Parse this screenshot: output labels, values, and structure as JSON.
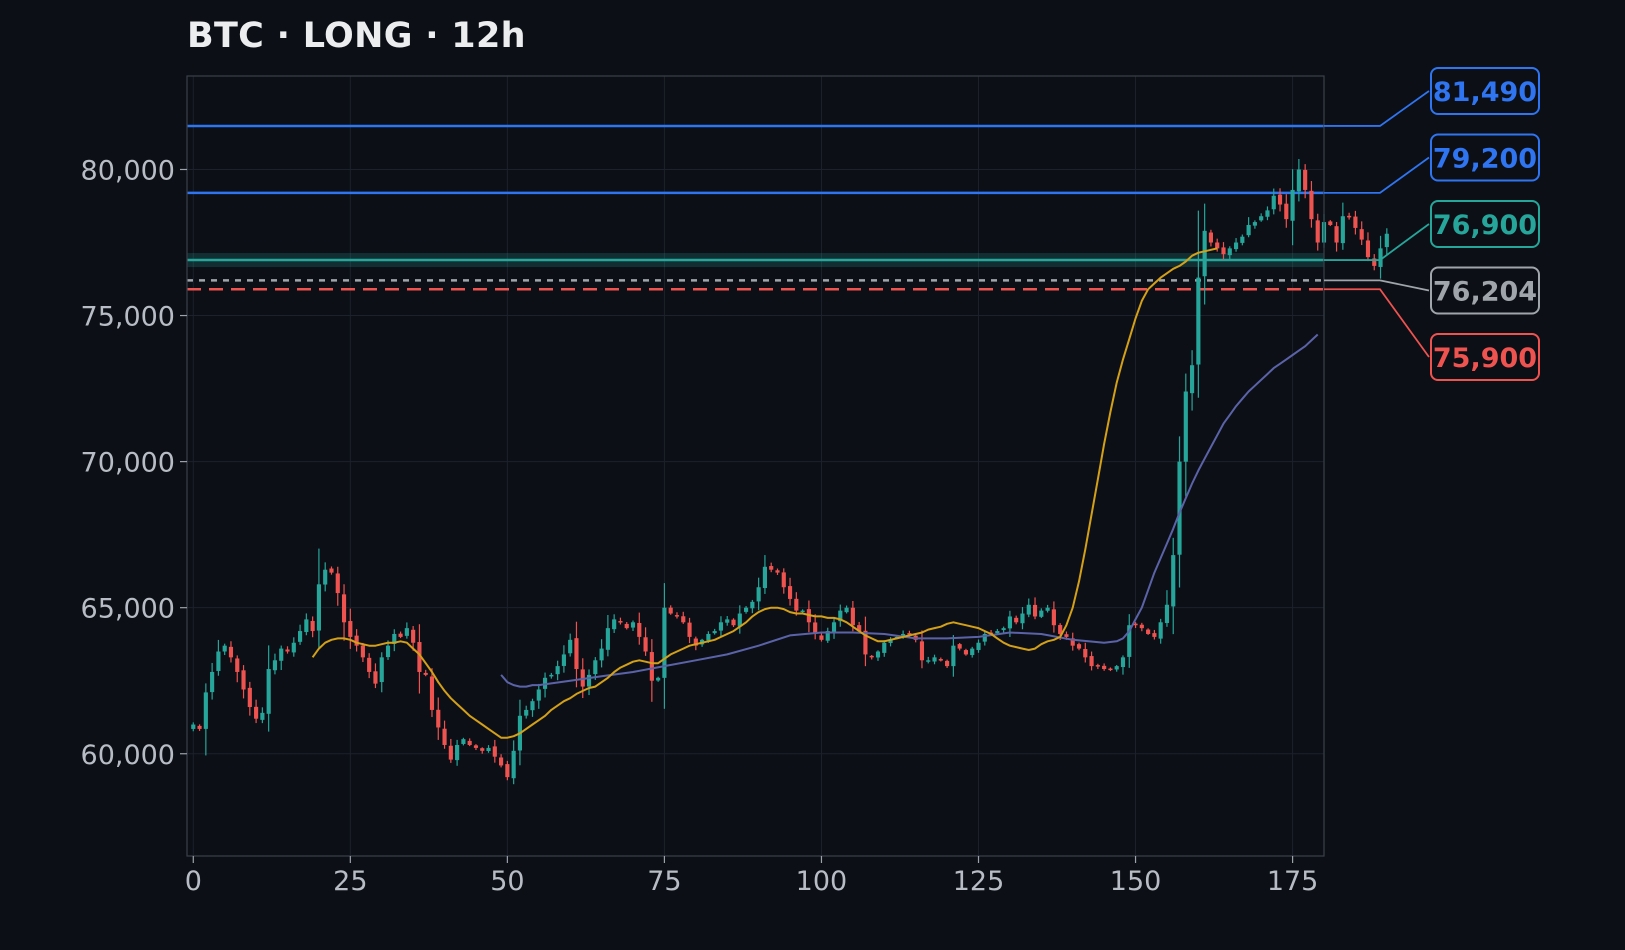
{
  "chart_data": {
    "type": "candlestick",
    "title": "BTC · LONG · 12h",
    "xlabel": "",
    "ylabel": "",
    "xlim": [
      -1,
      180
    ],
    "ylim": [
      56500,
      83200
    ],
    "grid": true,
    "x_ticks": [
      0,
      25,
      50,
      75,
      100,
      125,
      150,
      175
    ],
    "y_ticks": [
      60000,
      65000,
      70000,
      75000,
      80000
    ],
    "x_tick_labels": [
      "0",
      "25",
      "50",
      "75",
      "100",
      "125",
      "150",
      "175"
    ],
    "y_tick_labels": [
      "60,000",
      "65,000",
      "70,000",
      "75,000",
      "80,000"
    ],
    "colors": {
      "background": "#0c0f16",
      "up": "#26a69a",
      "down": "#ef5350",
      "ma_fast": "#d4a017",
      "ma_slow": "#5b63a8",
      "grid": "#1c212b",
      "frame": "#3a3f4a",
      "target": "#2f74f0",
      "entry": "#26a69a",
      "current": "#a0a4ab",
      "stop": "#ef5350"
    },
    "closes": [
      61000,
      60850,
      62100,
      62800,
      63500,
      63700,
      63300,
      62800,
      62200,
      61600,
      61200,
      61400,
      62900,
      63200,
      63600,
      63500,
      63800,
      64200,
      64600,
      64200,
      65800,
      66300,
      66200,
      65500,
      64500,
      64000,
      63700,
      63300,
      62800,
      62400,
      63300,
      63700,
      64100,
      64000,
      64300,
      63800,
      62800,
      62700,
      61500,
      60900,
      60300,
      59800,
      60300,
      60500,
      60300,
      60200,
      60100,
      60200,
      59900,
      59600,
      59200,
      60100,
      61300,
      61500,
      61800,
      62200,
      62600,
      62700,
      63000,
      63400,
      63900,
      62900,
      62300,
      62700,
      63200,
      63600,
      64300,
      64600,
      64500,
      64300,
      64500,
      64000,
      63500,
      62500,
      62600,
      65000,
      64800,
      64700,
      64500,
      64000,
      63700,
      63900,
      64100,
      64200,
      64500,
      64600,
      64400,
      64800,
      65000,
      65200,
      65700,
      66400,
      66300,
      66200,
      65700,
      65300,
      64900,
      64900,
      64500,
      64100,
      63900,
      64200,
      64500,
      64900,
      65000,
      64400,
      64200,
      63400,
      63300,
      63500,
      63800,
      63900,
      64000,
      64100,
      64100,
      63900,
      63200,
      63200,
      63300,
      63200,
      63000,
      63700,
      63600,
      63400,
      63600,
      63800,
      64100,
      64100,
      64200,
      64300,
      64700,
      64500,
      64800,
      65100,
      64700,
      64900,
      65000,
      64400,
      64100,
      64000,
      63700,
      63600,
      63300,
      63000,
      63000,
      62900,
      62900,
      63000,
      63300,
      64400,
      64400,
      64300,
      64100,
      64000,
      64500,
      65100,
      66800,
      70000,
      72400,
      73300,
      76300,
      77900,
      77500,
      77300,
      77100,
      77300,
      77500,
      77700,
      78100,
      78200,
      78400,
      78600,
      79100,
      78800,
      78300,
      79300,
      80000,
      79300,
      78300,
      77500,
      78200,
      78100,
      77500,
      78400,
      78400,
      78000,
      77600,
      77000,
      76700,
      77300,
      77800
    ],
    "ma_fast": {
      "x": [
        19,
        20,
        21,
        22,
        23,
        24,
        25,
        26,
        27,
        28,
        29,
        30,
        31,
        32,
        33,
        34,
        35,
        36,
        37,
        38,
        39,
        40,
        41,
        42,
        43,
        44,
        45,
        46,
        47,
        48,
        49,
        50,
        51,
        52,
        53,
        54,
        55,
        56,
        57,
        58,
        59,
        60,
        61,
        62,
        63,
        64,
        65,
        66,
        67,
        68,
        69,
        70,
        71,
        72,
        73,
        74,
        75,
        76,
        77,
        78,
        79,
        80,
        81,
        82,
        83,
        84,
        85,
        86,
        87,
        88,
        89,
        90,
        91,
        92,
        93,
        94,
        95,
        96,
        97,
        98,
        99,
        100,
        101,
        102,
        103,
        104,
        105,
        106,
        107,
        108,
        109,
        110,
        111,
        112,
        113,
        114,
        115,
        116,
        117,
        118,
        119,
        120,
        121,
        122,
        123,
        124,
        125,
        126,
        127,
        128,
        129,
        130,
        131,
        132,
        133,
        134,
        135,
        136,
        137,
        138,
        139,
        140,
        141,
        142,
        143,
        144,
        145,
        146,
        147,
        148,
        149,
        150,
        151,
        152,
        153,
        154,
        155,
        156,
        157,
        158,
        159,
        160,
        161,
        162,
        163,
        164,
        165,
        166,
        167,
        168,
        169,
        170,
        171,
        172,
        173,
        174,
        175,
        176,
        177,
        178,
        179
      ],
      "y": [
        63300,
        63600,
        63800,
        63900,
        63950,
        63950,
        63900,
        63800,
        63750,
        63700,
        63700,
        63750,
        63800,
        63800,
        63850,
        63800,
        63600,
        63400,
        63100,
        62800,
        62450,
        62150,
        61900,
        61700,
        61500,
        61300,
        61150,
        61000,
        60850,
        60700,
        60550,
        60550,
        60600,
        60700,
        60850,
        61000,
        61150,
        61300,
        61500,
        61650,
        61800,
        61900,
        62050,
        62150,
        62250,
        62300,
        62450,
        62600,
        62800,
        62950,
        63050,
        63150,
        63200,
        63150,
        63100,
        63100,
        63250,
        63400,
        63500,
        63600,
        63700,
        63750,
        63800,
        63850,
        63900,
        64000,
        64100,
        64200,
        64350,
        64500,
        64700,
        64850,
        64950,
        65000,
        65000,
        64950,
        64850,
        64800,
        64800,
        64750,
        64700,
        64700,
        64650,
        64650,
        64600,
        64500,
        64350,
        64200,
        64050,
        63950,
        63850,
        63850,
        63900,
        63950,
        64000,
        64050,
        64100,
        64150,
        64250,
        64300,
        64350,
        64450,
        64500,
        64450,
        64400,
        64350,
        64300,
        64200,
        64100,
        63950,
        63800,
        63700,
        63650,
        63600,
        63550,
        63600,
        63750,
        63850,
        63900,
        64000,
        64400,
        65000,
        65900,
        67000,
        68200,
        69400,
        70600,
        71700,
        72700,
        73500,
        74200,
        74900,
        75500,
        75900,
        76100,
        76300,
        76450,
        76600,
        76700,
        76850,
        77050,
        77150,
        77200,
        77250,
        77300
      ],
      "name": ""
    },
    "ma_slow": {
      "x": [
        49,
        50,
        51,
        52,
        53,
        54,
        55,
        60,
        65,
        70,
        75,
        80,
        85,
        90,
        95,
        100,
        105,
        110,
        115,
        120,
        125,
        130,
        135,
        140,
        145,
        147,
        148,
        149,
        150,
        151,
        152,
        153,
        154,
        155,
        156,
        157,
        158,
        159,
        160,
        161,
        162,
        163,
        164,
        165,
        166,
        167,
        168,
        169,
        170,
        171,
        172,
        173,
        174,
        175,
        176,
        177,
        178,
        179
      ],
      "y": [
        62700,
        62450,
        62350,
        62300,
        62300,
        62350,
        62350,
        62500,
        62650,
        62800,
        63000,
        63200,
        63400,
        63700,
        64050,
        64150,
        64150,
        64100,
        63950,
        63950,
        64000,
        64150,
        64100,
        63900,
        63800,
        63850,
        63950,
        64200,
        64600,
        65000,
        65600,
        66200,
        66700,
        67200,
        67700,
        68250,
        68750,
        69250,
        69700,
        70100,
        70500,
        70900,
        71300,
        71600,
        71900,
        72150,
        72400,
        72600,
        72800,
        73000,
        73200,
        73350,
        73500,
        73650,
        73800,
        73950,
        74150,
        74350
      ],
      "name": ""
    },
    "levels": [
      {
        "key": "target2",
        "value": 81490,
        "label": "81,490",
        "color": "#2f74f0",
        "style": "solid",
        "label_row": 0
      },
      {
        "key": "target1",
        "value": 79200,
        "label": "79,200",
        "color": "#2f74f0",
        "style": "solid",
        "label_row": 1
      },
      {
        "key": "entry",
        "value": 76900,
        "label": "76,900",
        "color": "#26a69a",
        "style": "zone",
        "label_row": 2
      },
      {
        "key": "current",
        "value": 76204,
        "label": "76,204",
        "color": "#a0a4ab",
        "style": "dotted",
        "label_row": 3
      },
      {
        "key": "stop",
        "value": 75900,
        "label": "75,900",
        "color": "#ef5350",
        "style": "dashed",
        "label_row": 4
      }
    ]
  }
}
